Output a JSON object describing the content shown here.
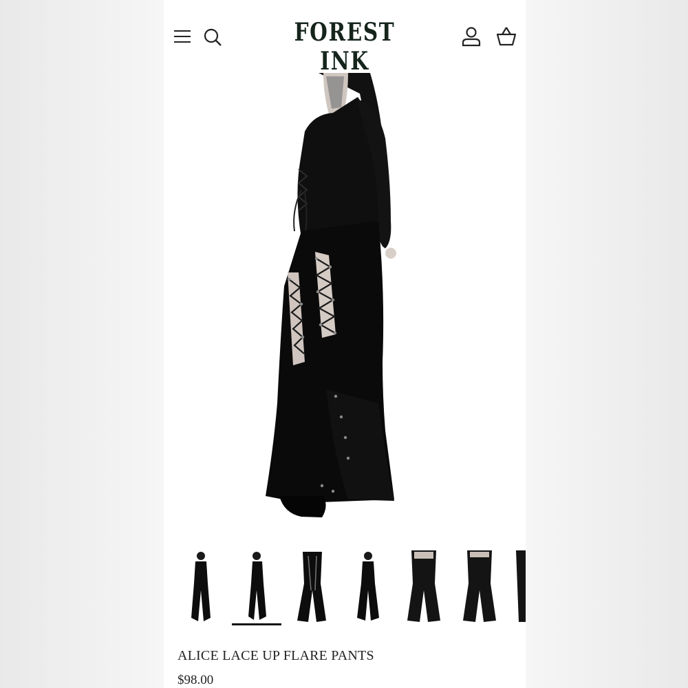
{
  "header": {
    "logo_text": "FOREST INK",
    "icons": [
      "menu-icon",
      "search-icon",
      "account-icon",
      "cart-icon"
    ]
  },
  "product": {
    "title": "ALICE LACE UP FLARE PANTS",
    "price": "$98.00"
  },
  "gallery": {
    "thumbnail_count": 7,
    "selected_index": 2
  },
  "colors": {
    "logo": "#16251c",
    "text": "#222222",
    "garment": "#0d0d0d",
    "background": "#ffffff"
  }
}
